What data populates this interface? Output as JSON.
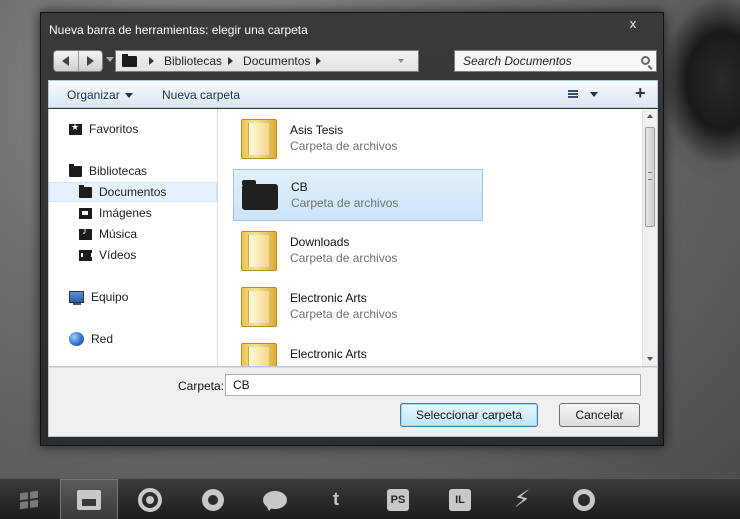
{
  "window": {
    "title": "Nueva barra de herramientas: elegir una carpeta",
    "close_glyph": "x"
  },
  "address": {
    "crumbs": [
      "Bibliotecas",
      "Documentos"
    ],
    "search_placeholder": "Search Documentos"
  },
  "toolbar": {
    "organize_label": "Organizar",
    "new_folder_label": "Nueva carpeta",
    "add_glyph": "+"
  },
  "sidebar": {
    "items": [
      {
        "label": "Favoritos",
        "icon": "star-icon"
      },
      {
        "label": "Bibliotecas",
        "icon": "library-icon"
      },
      {
        "label": "Documentos",
        "icon": "documents-icon",
        "selected": true
      },
      {
        "label": "Imágenes",
        "icon": "pictures-icon"
      },
      {
        "label": "Música",
        "icon": "music-icon"
      },
      {
        "label": "Vídeos",
        "icon": "videos-icon"
      },
      {
        "label": "Equipo",
        "icon": "computer-icon"
      },
      {
        "label": "Red",
        "icon": "network-icon"
      }
    ]
  },
  "files": {
    "items": [
      {
        "name": "Asis Tesis",
        "type": "Carpeta de archivos",
        "icon": "folder-yellow-icon"
      },
      {
        "name": "CB",
        "type": "Carpeta de archivos",
        "icon": "folder-black-icon",
        "selected": true
      },
      {
        "name": "Downloads",
        "type": "Carpeta de archivos",
        "icon": "folder-yellow-icon"
      },
      {
        "name": "Electronic Arts",
        "type": "Carpeta de archivos",
        "icon": "folder-yellow-icon"
      },
      {
        "name": "Electronic Arts",
        "type": "",
        "icon": "folder-yellow-icon"
      }
    ]
  },
  "bottom": {
    "folder_label": "Carpeta:",
    "folder_value": "CB",
    "select_label": "Seleccionar carpeta",
    "cancel_label": "Cancelar"
  },
  "taskbar": {
    "ps_label": "PS",
    "il_label": "IL",
    "twitter_label": "t",
    "bolt_label": "⚡"
  },
  "colors": {
    "selection": "#cbe4f8",
    "toolbar_text": "#1e3150",
    "primary_button_border": "#3c7fb1"
  }
}
